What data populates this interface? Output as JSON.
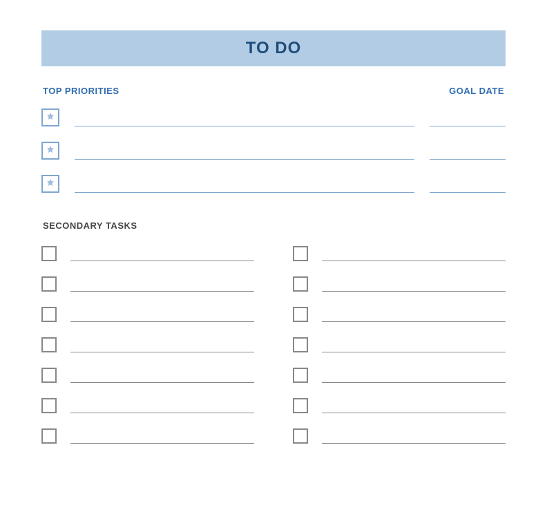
{
  "title": "TO DO",
  "headings": {
    "top_priorities": "TOP PRIORITIES",
    "goal_date": "GOAL DATE",
    "secondary_tasks": "SECONDARY TASKS"
  },
  "priorities": [
    {
      "task": "",
      "goal_date": ""
    },
    {
      "task": "",
      "goal_date": ""
    },
    {
      "task": "",
      "goal_date": ""
    }
  ],
  "secondary_left": [
    {
      "task": ""
    },
    {
      "task": ""
    },
    {
      "task": ""
    },
    {
      "task": ""
    },
    {
      "task": ""
    },
    {
      "task": ""
    },
    {
      "task": ""
    }
  ],
  "secondary_right": [
    {
      "task": ""
    },
    {
      "task": ""
    },
    {
      "task": ""
    },
    {
      "task": ""
    },
    {
      "task": ""
    },
    {
      "task": ""
    },
    {
      "task": ""
    }
  ],
  "colors": {
    "title_bg": "#b3cce6",
    "title_text": "#1f4e79",
    "priority_accent": "#7fa6d0",
    "heading_blue": "#2e6bb0",
    "secondary_gray": "#888888"
  }
}
